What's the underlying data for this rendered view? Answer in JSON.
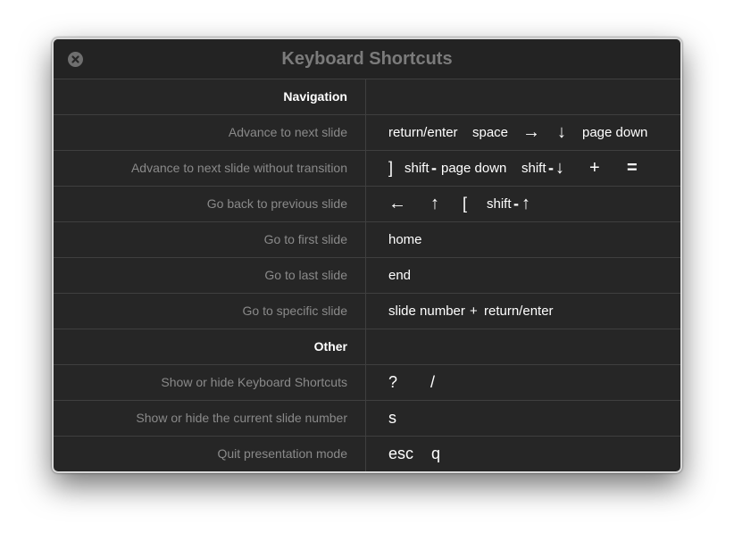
{
  "dialog": {
    "title": "Keyboard Shortcuts",
    "close_icon": "close-icon"
  },
  "rows": [
    {
      "action": "Navigation",
      "section": true
    },
    {
      "action": "Advance to next slide",
      "keys": {
        "k1": "return/enter",
        "k2": "space",
        "k3": "→",
        "k4": "↓",
        "k5": "page down"
      }
    },
    {
      "action": "Advance to next slide without transition",
      "keys": {
        "k1": "]",
        "k2": "shift",
        "k3": "-",
        "k4": "page down",
        "k5": "shift",
        "k6": "-",
        "k7": "↓",
        "k8": "+",
        "k9": "="
      }
    },
    {
      "action": "Go back to previous slide",
      "keys": {
        "k1": "←",
        "k2": "↑",
        "k3": "[",
        "k4": "shift",
        "k5": "-",
        "k6": "↑"
      }
    },
    {
      "action": "Go to first slide",
      "keys": {
        "k1": "home"
      }
    },
    {
      "action": "Go to last slide",
      "keys": {
        "k1": "end"
      }
    },
    {
      "action": "Go to specific slide",
      "keys": {
        "k1": "slide number",
        "k2": "+",
        "k3": "return/enter"
      }
    },
    {
      "action": "Other",
      "section": true
    },
    {
      "action": "Show or hide Keyboard Shortcuts",
      "keys": {
        "k1": "?",
        "k2": "/"
      }
    },
    {
      "action": "Show or hide the current slide number",
      "keys": {
        "k1": "s"
      }
    },
    {
      "action": "Quit presentation mode",
      "keys": {
        "k1": "esc",
        "k2": "q"
      }
    }
  ],
  "colors": {
    "background": "#262626",
    "divider": "#3f3f3f",
    "action_text": "#8a8a8a",
    "key_text": "#ffffff",
    "title_text": "#7b7b7b"
  }
}
